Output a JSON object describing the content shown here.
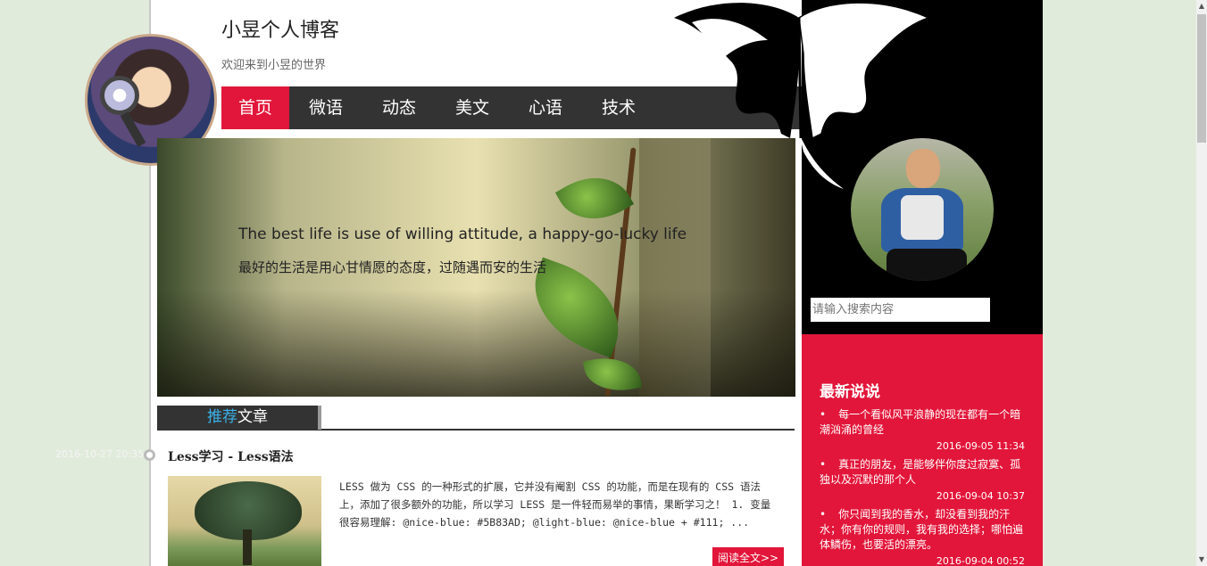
{
  "header": {
    "title": "小昱个人博客",
    "subtitle": "欢迎来到小昱的世界"
  },
  "nav": {
    "items": [
      {
        "label": "首页",
        "active": true
      },
      {
        "label": "微语",
        "active": false
      },
      {
        "label": "动态",
        "active": false
      },
      {
        "label": "美文",
        "active": false
      },
      {
        "label": "心语",
        "active": false
      },
      {
        "label": "技术",
        "active": false
      }
    ]
  },
  "banner": {
    "quote_en": "The best life is use of willing attitude, a happy-go-lucky life",
    "quote_zh": "最好的生活是用心甘情愿的态度，过随遇而安的生活"
  },
  "section": {
    "title_highlight": "推荐",
    "title_rest": "文章"
  },
  "article": {
    "date": "2016-10-27 20:35",
    "title": "Less学习 - Less语法",
    "summary": "LESS 做为 CSS 的一种形式的扩展，它并没有阉割 CSS 的功能，而是在现有的 CSS 语法上，添加了很多额外的功能，所以学习 LESS 是一件轻而易举的事情，果断学习之！ 1. 变量 很容易理解: @nice-blue: #5B83AD; @light-blue: @nice-blue + #111; ...",
    "read_more": "阅读全文>>"
  },
  "sidebar": {
    "search_placeholder": "请输入搜索内容",
    "news_title": "最新说说",
    "news": [
      {
        "text": "每一个看似风平浪静的现在都有一个暗潮汹涌的曾经",
        "time": "2016-09-05 11:34"
      },
      {
        "text": "真正的朋友，是能够伴你度过寂寞、孤独以及沉默的那个人",
        "time": "2016-09-04 10:37"
      },
      {
        "text": "你只闻到我的香水，却没看到我的汗水；你有你的规则，我有我的选择；哪怕遍体鳞伤，也要活的漂亮。",
        "time": "2016-09-04 00:52"
      }
    ]
  },
  "colors": {
    "accent": "#e2163a",
    "nav_bg": "#333333",
    "page_bg": "#e1ebdb",
    "highlight_blue": "#3ab1e8"
  },
  "icons": {
    "scroll_up": "▲",
    "scroll_down": "▼"
  }
}
